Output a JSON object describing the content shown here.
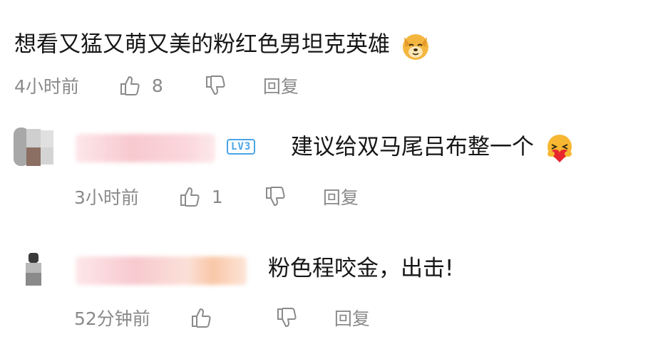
{
  "comments": [
    {
      "text": "想看又猛又萌又美的粉红色男坦克英雄",
      "emoji_icon": "dog-face-emoji",
      "time": "4小时前",
      "likes": "8",
      "reply_label": "回复"
    },
    {
      "level_badge": "LV3",
      "text": "建议给双马尾吕布整一个",
      "emoji_icon": "heart-hugging-emoji",
      "time": "3小时前",
      "likes": "1",
      "reply_label": "回复"
    },
    {
      "text": "粉色程咬金，出击!",
      "time": "52分钟前",
      "likes": "",
      "reply_label": "回复"
    }
  ],
  "colors": {
    "meta_gray": "#8a8a8a",
    "level_blue": "#4aa4e6",
    "name_blur_pink": "#f7c9cf"
  }
}
